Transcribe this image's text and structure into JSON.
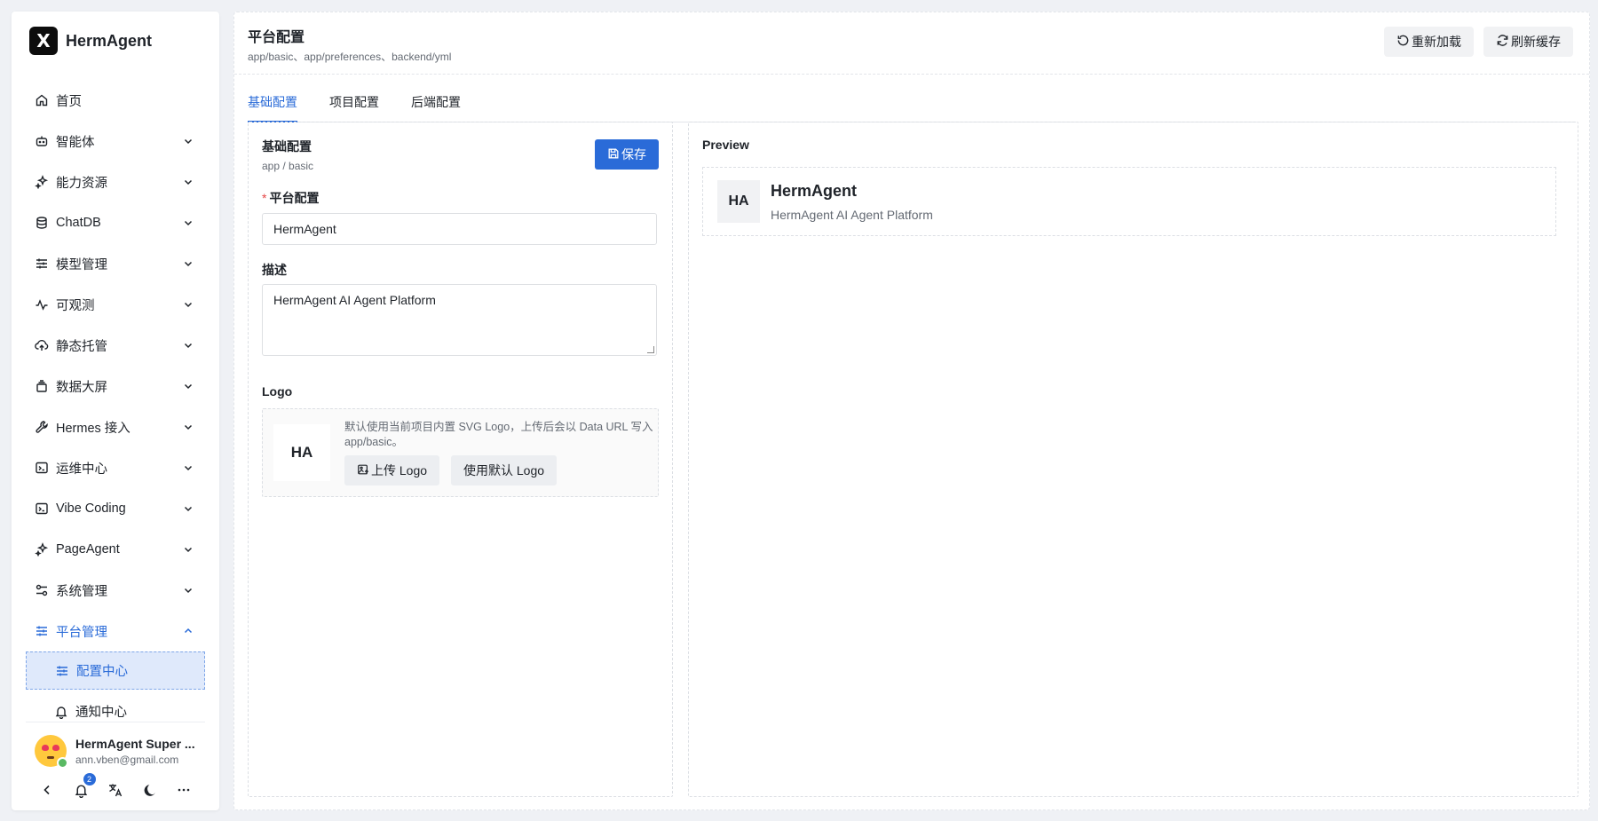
{
  "brand": {
    "logo_text": "X",
    "name": "HermAgent"
  },
  "sidebar": {
    "items": [
      {
        "label": "首页",
        "icon": "home-icon"
      },
      {
        "label": "智能体",
        "icon": "bot-icon"
      },
      {
        "label": "能力资源",
        "icon": "sparkles-icon"
      },
      {
        "label": "ChatDB",
        "icon": "database-icon"
      },
      {
        "label": "模型管理",
        "icon": "sliders-icon"
      },
      {
        "label": "可观测",
        "icon": "activity-icon"
      },
      {
        "label": "静态托管",
        "icon": "cloud-upload-icon"
      },
      {
        "label": "数据大屏",
        "icon": "stack-icon"
      },
      {
        "label": "Hermes 接入",
        "icon": "wrench-icon"
      },
      {
        "label": "运维中心",
        "icon": "terminal-icon"
      },
      {
        "label": "Vibe Coding",
        "icon": "terminal-icon"
      },
      {
        "label": "PageAgent",
        "icon": "sparkles-icon"
      },
      {
        "label": "系统管理",
        "icon": "settings-icon"
      },
      {
        "label": "平台管理",
        "icon": "sliders-icon"
      }
    ],
    "sub_items": [
      {
        "label": "配置中心",
        "icon": "sliders-icon"
      },
      {
        "label": "通知中心",
        "icon": "bell-icon"
      }
    ],
    "user": {
      "name": "HermAgent Super ...",
      "email": "ann.vben@gmail.com"
    },
    "notification_count": "2"
  },
  "header": {
    "title": "平台配置",
    "subtitle": "app/basic、app/preferences、backend/yml",
    "reload_label": "重新加载",
    "refresh_label": "刷新缓存"
  },
  "tabs": [
    {
      "label": "基础配置"
    },
    {
      "label": "项目配置"
    },
    {
      "label": "后端配置"
    }
  ],
  "form": {
    "title": "基础配置",
    "subtitle": "app / basic",
    "save_label": "保存",
    "name_label": "平台配置",
    "required_mark": "*",
    "name_value": "HermAgent",
    "desc_label": "描述",
    "desc_value": "HermAgent AI Agent Platform",
    "logo_label": "Logo",
    "logo_tile": "HA",
    "logo_desc": "默认使用当前项目内置 SVG Logo，上传后会以 Data URL 写入 app/basic。",
    "upload_label": "上传 Logo",
    "default_label": "使用默认 Logo"
  },
  "preview": {
    "title": "Preview",
    "tile": "HA",
    "name": "HermAgent",
    "desc": "HermAgent AI Agent Platform"
  },
  "colors": {
    "accent": "#2a6bd8",
    "brand_bg": "#0d0d0d"
  }
}
